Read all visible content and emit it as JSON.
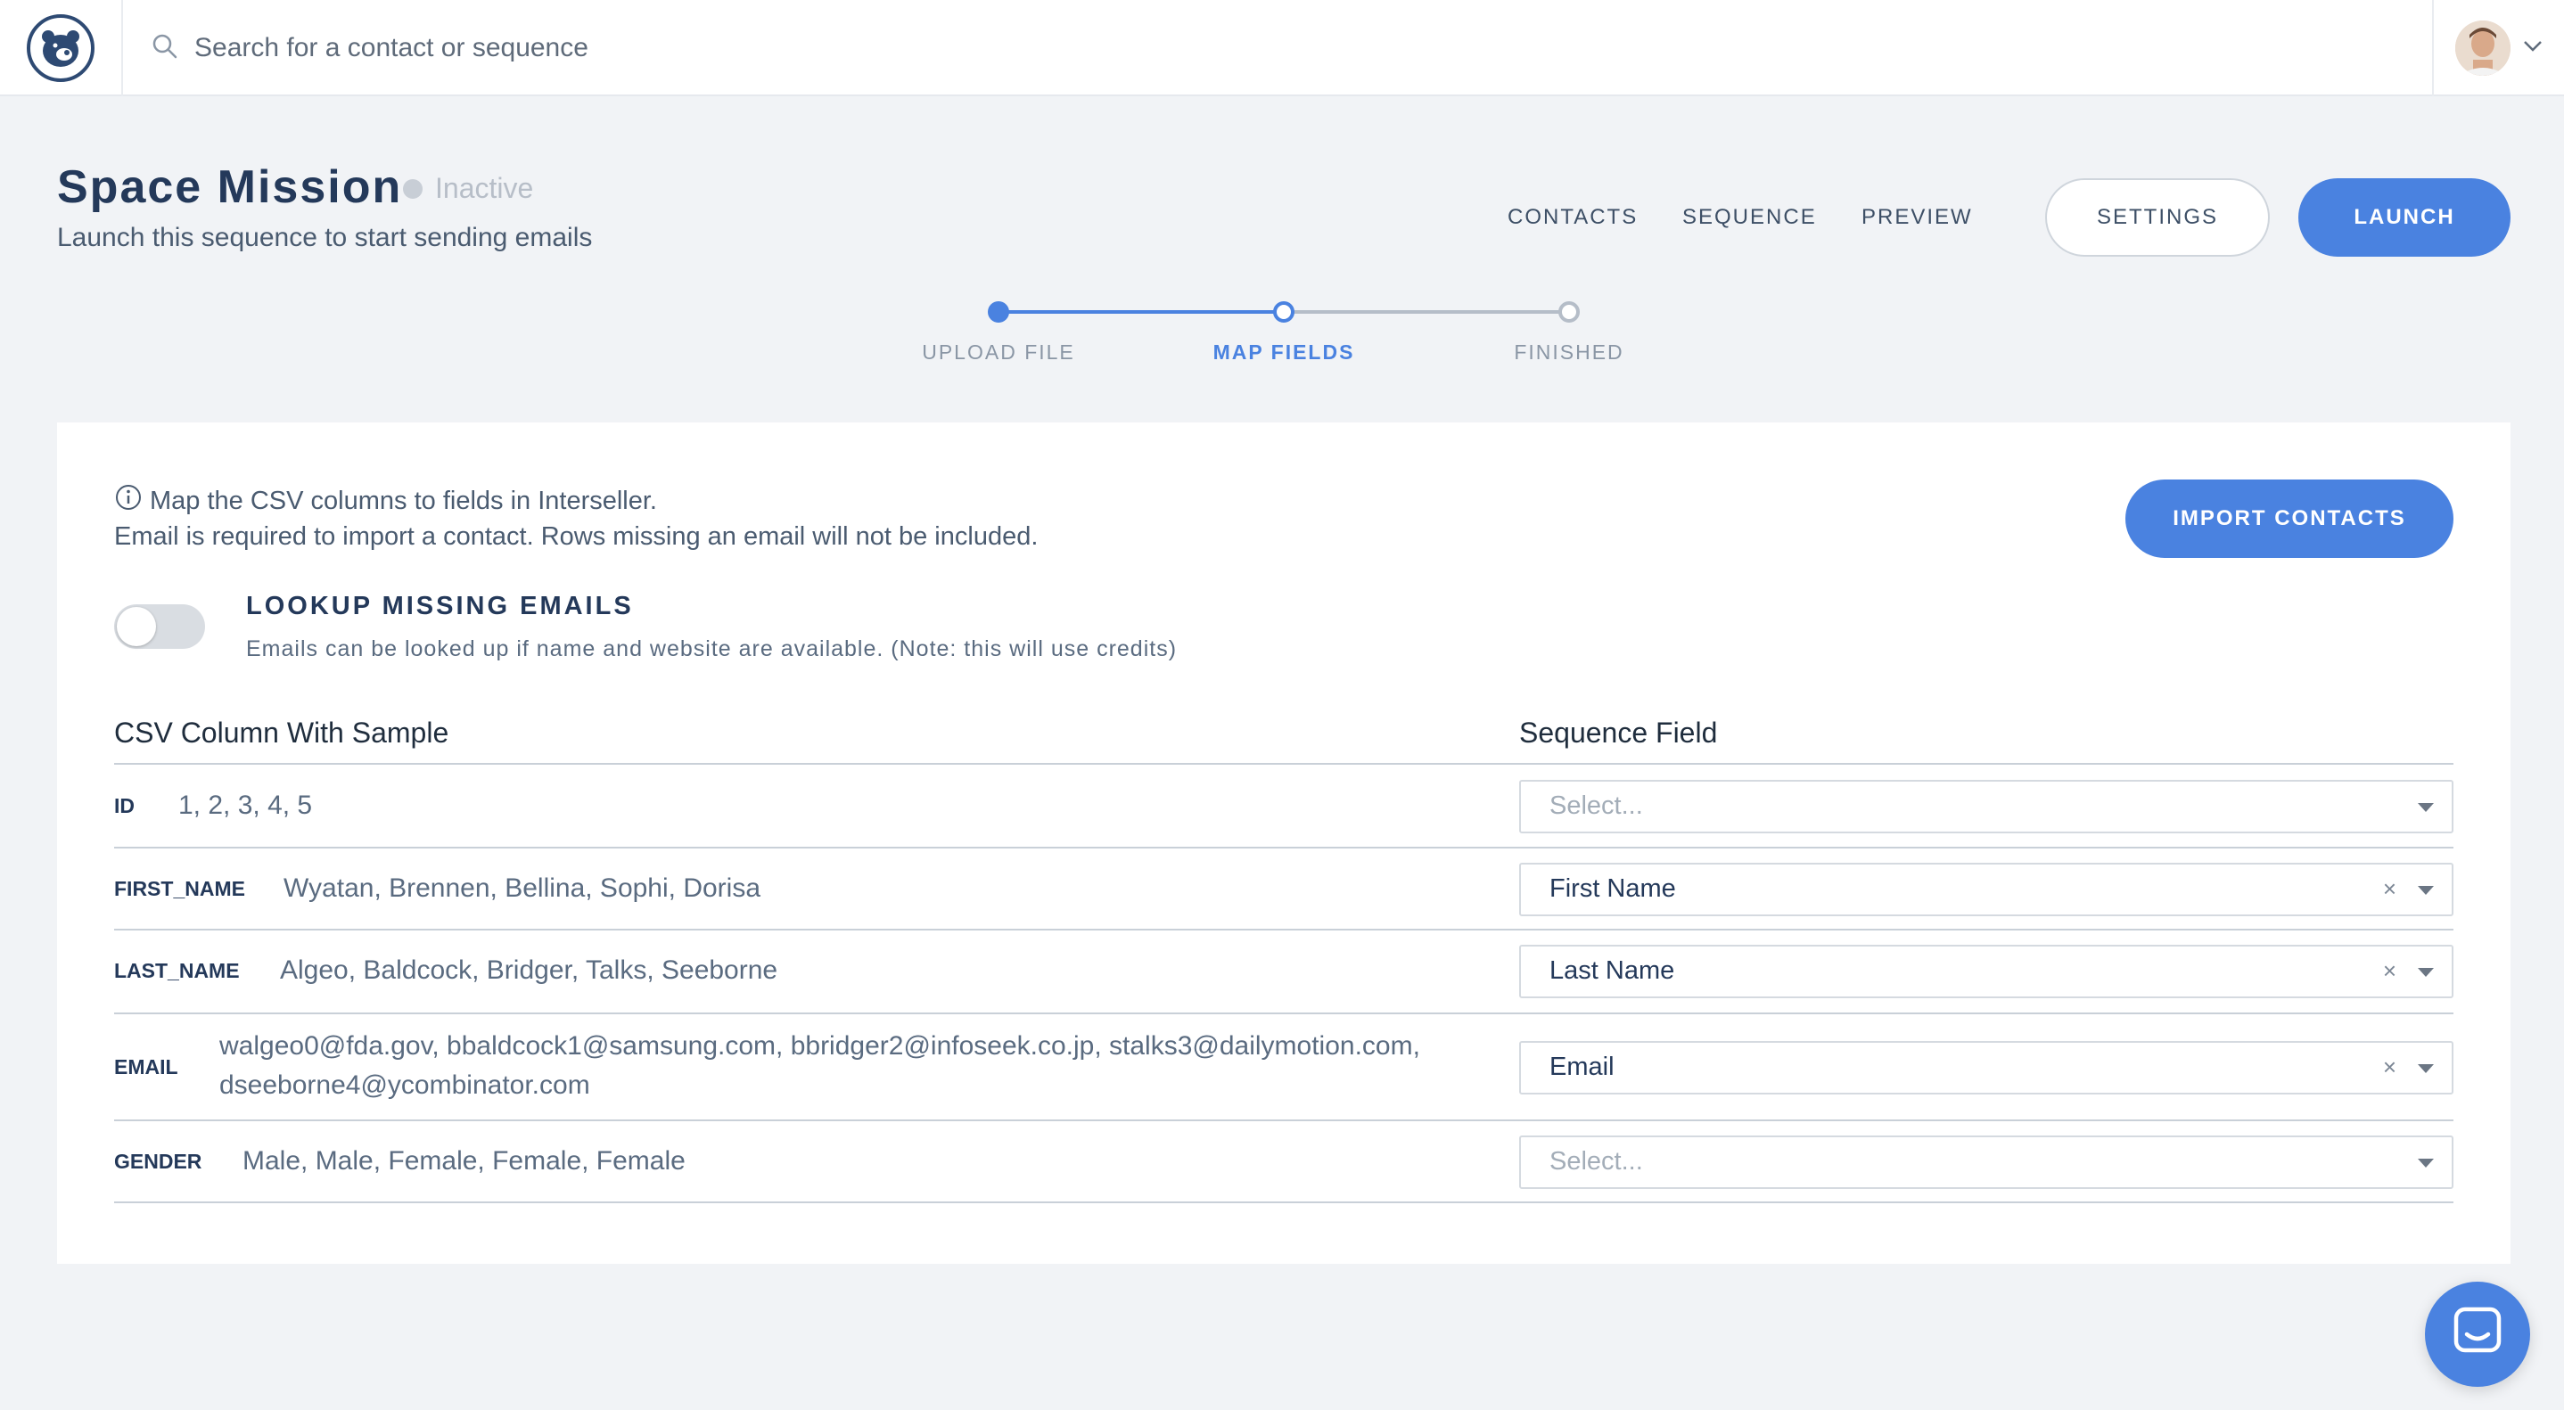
{
  "topbar": {
    "search_placeholder": "Search for a contact or sequence",
    "logo_icon": "bear-logo-icon",
    "avatar": "user-avatar",
    "menu_icon": "chevron-down-icon"
  },
  "header": {
    "title": "Space Mission",
    "status": "Inactive",
    "subtitle": "Launch this sequence to start sending emails",
    "nav": [
      "CONTACTS",
      "SEQUENCE",
      "PREVIEW"
    ],
    "settings_label": "SETTINGS",
    "launch_label": "LAUNCH"
  },
  "stepper": {
    "steps": [
      "UPLOAD FILE",
      "MAP FIELDS",
      "FINISHED"
    ],
    "current_step": 2
  },
  "card": {
    "info_line1": "Map the CSV columns to fields in Interseller.",
    "info_line2": "Email is required to import a contact. Rows missing an email will not be included.",
    "import_label": "IMPORT CONTACTS",
    "lookup_title": "LOOKUP MISSING EMAILS",
    "lookup_desc": "Emails can be looked up if name and website are available. (Note: this will use credits)",
    "lookup_enabled": false,
    "col_header_csv": "CSV Column With Sample",
    "col_header_field": "Sequence Field",
    "rows": [
      {
        "name": "ID",
        "sample": "1, 2, 3, 4, 5",
        "field": "Select...",
        "mapped": false
      },
      {
        "name": "FIRST_NAME",
        "sample": "Wyatan, Brennen, Bellina, Sophi, Dorisa",
        "field": "First Name",
        "mapped": true
      },
      {
        "name": "LAST_NAME",
        "sample": "Algeo, Baldcock, Bridger, Talks, Seeborne",
        "field": "Last Name",
        "mapped": true
      },
      {
        "name": "EMAIL",
        "sample": "walgeo0@fda.gov, bbaldcock1@samsung.com, bbridger2@infoseek.co.jp, stalks3@dailymotion.com,",
        "sample_cont": "dseeborne4@ycombinator.com",
        "field": "Email",
        "mapped": true
      },
      {
        "name": "GENDER",
        "sample": "Male, Male, Female, Female, Female",
        "field": "Select...",
        "mapped": false
      }
    ],
    "clear_glyph": "×"
  },
  "colors": {
    "primary": "#4a82e0",
    "title": "#24395a",
    "inactive": "#c8ced6"
  }
}
